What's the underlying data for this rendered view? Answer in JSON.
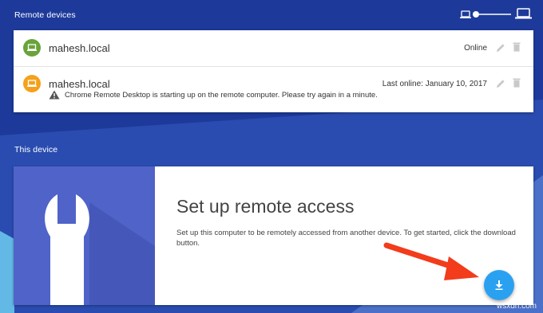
{
  "remote_devices": {
    "title": "Remote devices",
    "devices": [
      {
        "name": "mahesh.local",
        "status": "Online",
        "icon": "laptop-icon",
        "color": "#6aa33a"
      },
      {
        "name": "mahesh.local",
        "status": "Last online: January 10, 2017",
        "icon": "laptop-icon",
        "color": "#f5a11b",
        "warning": "Chrome Remote Desktop is starting up on the remote computer. Please try again in a minute."
      }
    ]
  },
  "this_device": {
    "title": "This device",
    "setup_title": "Set up remote access",
    "setup_desc": "Set up this computer to be remotely accessed from another device. To get started, click the download button."
  },
  "watermark": "wsxdn.com",
  "colors": {
    "background": "#1d3a9b",
    "accent": "#2aa1f0",
    "illustration": "#5063c9",
    "arrow": "#f23c1c"
  }
}
